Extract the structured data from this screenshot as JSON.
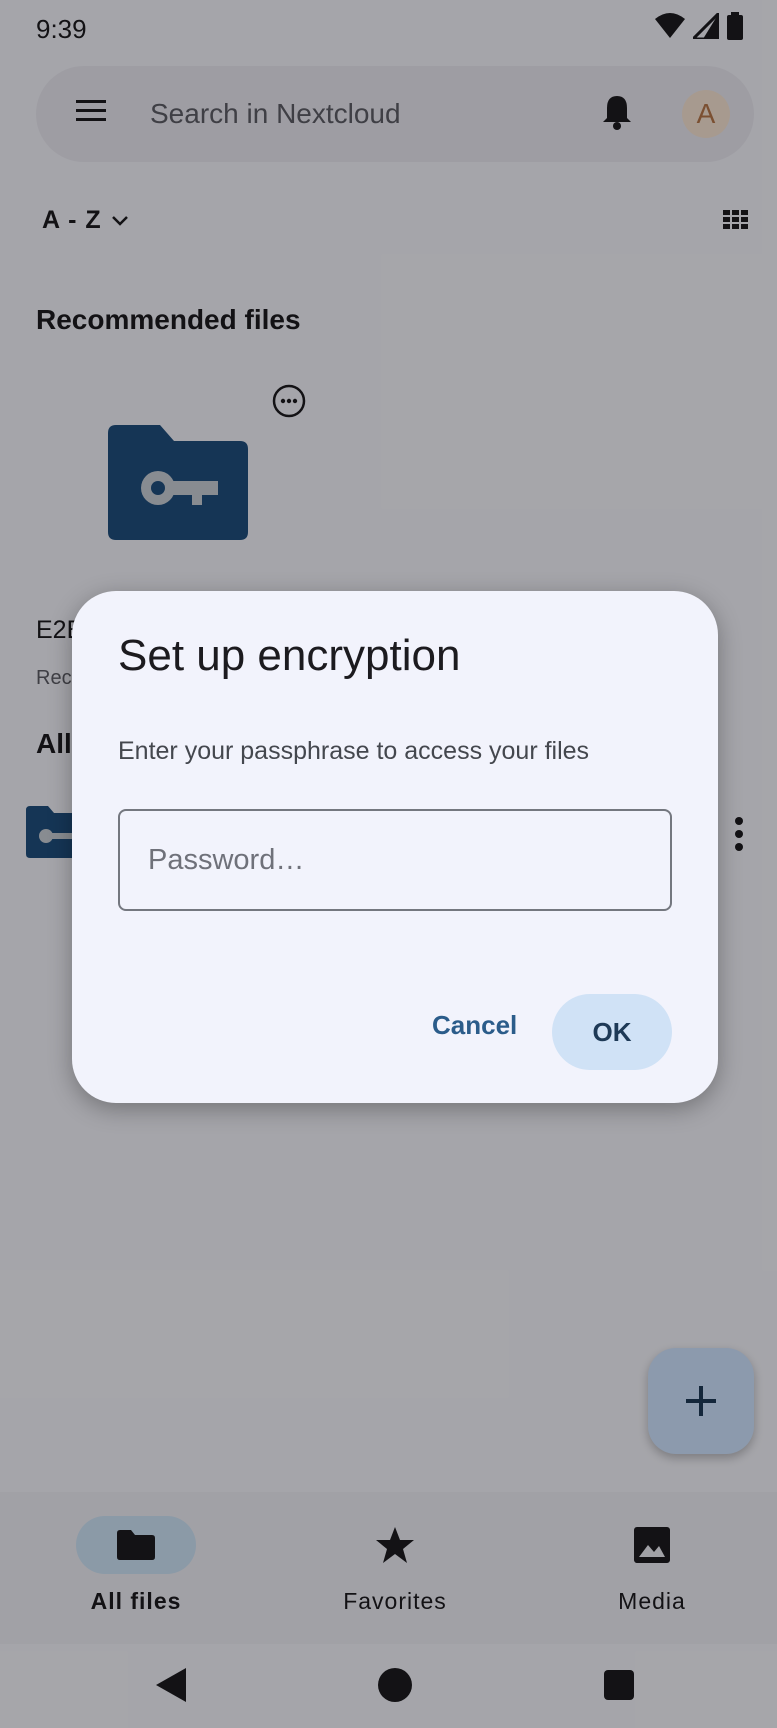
{
  "status_bar": {
    "time": "9:39"
  },
  "search": {
    "placeholder": "Search in Nextcloud",
    "avatar_letter": "A"
  },
  "sort": {
    "label": "A - Z"
  },
  "recommended": {
    "title": "Recommended files",
    "item_name": "E2E",
    "item_sub": "Rec"
  },
  "all_files": {
    "title": "All"
  },
  "bottom_nav": {
    "items": [
      {
        "label": "All files",
        "icon": "folder-icon",
        "active": true
      },
      {
        "label": "Favorites",
        "icon": "star-icon",
        "active": false
      },
      {
        "label": "Media",
        "icon": "image-icon",
        "active": false
      }
    ]
  },
  "dialog": {
    "title": "Set up encryption",
    "message": "Enter your passphrase to access your files",
    "password_placeholder": "Password…",
    "cancel_label": "Cancel",
    "ok_label": "OK"
  },
  "colors": {
    "folder": "#1f4f7e",
    "ok_button": "#d0e2f6",
    "cancel_text": "#2b5c8a",
    "fab": "#cfe3ff"
  }
}
